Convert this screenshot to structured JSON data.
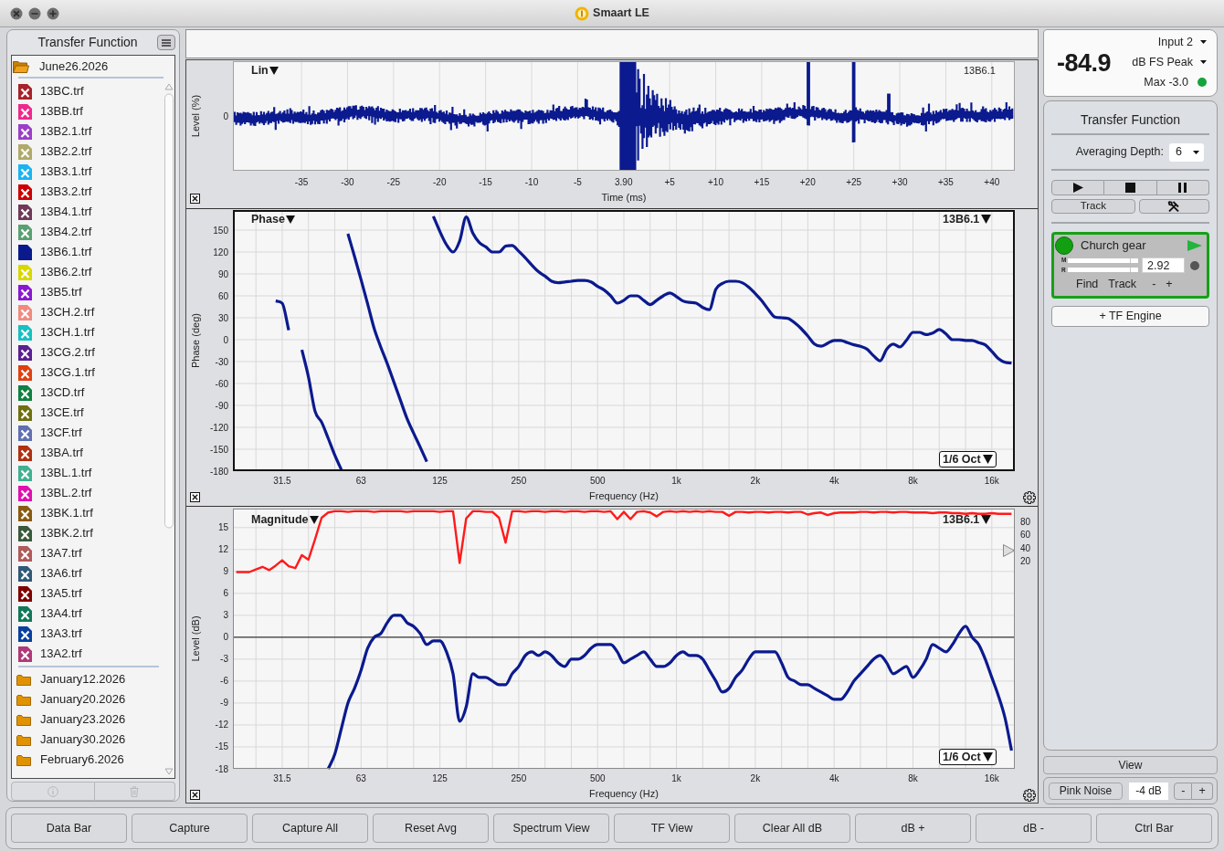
{
  "window": {
    "title": "Smaart LE"
  },
  "sidebar": {
    "title": "Transfer Function",
    "folders": [
      {
        "name": "June26.2026",
        "expanded": true,
        "files": [
          {
            "name": "13BC.trf",
            "color": "#a8222a",
            "visible": false
          },
          {
            "name": "13BB.trf",
            "color": "#f0288c",
            "visible": false
          },
          {
            "name": "13B2.1.trf",
            "color": "#9b3fc8",
            "visible": false
          },
          {
            "name": "13B2.2.trf",
            "color": "#b0aa6a",
            "visible": false
          },
          {
            "name": "13B3.1.trf",
            "color": "#1ab4f0",
            "visible": false
          },
          {
            "name": "13B3.2.trf",
            "color": "#cc0000",
            "visible": false
          },
          {
            "name": "13B4.1.trf",
            "color": "#6e3a58",
            "visible": false
          },
          {
            "name": "13B4.2.trf",
            "color": "#5aa070",
            "visible": false
          },
          {
            "name": "13B6.1.trf",
            "color": "#0a1a8c",
            "visible": true
          },
          {
            "name": "13B6.2.trf",
            "color": "#d8d800",
            "visible": false
          },
          {
            "name": "13B5.trf",
            "color": "#8a18d0",
            "visible": false
          },
          {
            "name": "13CH.2.trf",
            "color": "#f08a80",
            "visible": false
          },
          {
            "name": "13CH.1.trf",
            "color": "#18c0c0",
            "visible": false
          },
          {
            "name": "13CG.2.trf",
            "color": "#5a2090",
            "visible": false
          },
          {
            "name": "13CG.1.trf",
            "color": "#e04010",
            "visible": false
          },
          {
            "name": "13CD.trf",
            "color": "#108040",
            "visible": false
          },
          {
            "name": "13CE.trf",
            "color": "#707010",
            "visible": false
          },
          {
            "name": "13CF.trf",
            "color": "#6070b0",
            "visible": false
          },
          {
            "name": "13BA.trf",
            "color": "#b03010",
            "visible": false
          },
          {
            "name": "13BL.1.trf",
            "color": "#40b090",
            "visible": false
          },
          {
            "name": "13BL.2.trf",
            "color": "#e010b0",
            "visible": false
          },
          {
            "name": "13BK.1.trf",
            "color": "#8a5a10",
            "visible": false
          },
          {
            "name": "13BK.2.trf",
            "color": "#3a5a3a",
            "visible": false
          },
          {
            "name": "13A7.trf",
            "color": "#b05a5a",
            "visible": false
          },
          {
            "name": "13A6.trf",
            "color": "#305878",
            "visible": false
          },
          {
            "name": "13A5.trf",
            "color": "#800000",
            "visible": false
          },
          {
            "name": "13A4.trf",
            "color": "#107858",
            "visible": false
          },
          {
            "name": "13A3.trf",
            "color": "#0840a0",
            "visible": false
          },
          {
            "name": "13A2.trf",
            "color": "#b03878",
            "visible": false
          }
        ]
      },
      {
        "name": "January12.2026",
        "expanded": false
      },
      {
        "name": "January20.2026",
        "expanded": false
      },
      {
        "name": "January23.2026",
        "expanded": false
      },
      {
        "name": "January30.2026",
        "expanded": false
      },
      {
        "name": "February6.2026",
        "expanded": false
      }
    ],
    "footer_buttons": [
      {
        "kind": "info",
        "disabled": true
      },
      {
        "kind": "trash",
        "disabled": true
      }
    ]
  },
  "impulse_pane": {
    "selected": false,
    "mode": "Lin",
    "trace_label": "13B6.1",
    "ylabel": "Level (%)",
    "yticks": [
      "0"
    ],
    "xticks": [
      "-35",
      "-30",
      "-25",
      "-20",
      "-15",
      "-10",
      "-5",
      "3.90",
      "+5",
      "+10",
      "+15",
      "+20",
      "+25",
      "+30",
      "+35",
      "+40"
    ],
    "xlabel": "Time (ms)"
  },
  "phase_pane": {
    "selected": true,
    "mode": "Phase",
    "smoothing": "1/6 Oct",
    "chart_data": {
      "type": "line",
      "xlabel": "Frequency (Hz)",
      "ylabel": "Phase (deg)",
      "grid": true,
      "categories": [
        null,
        null,
        null,
        null,
        null,
        null,
        null,
        "31.5",
        null,
        null,
        null,
        null,
        null,
        null,
        null,
        null,
        null,
        null,
        null,
        "63",
        null,
        null,
        null,
        null,
        null,
        null,
        null,
        null,
        null,
        null,
        null,
        "125",
        null,
        null,
        null,
        null,
        null,
        null,
        null,
        null,
        null,
        null,
        null,
        "250",
        null,
        null,
        null,
        null,
        null,
        null,
        null,
        null,
        null,
        null,
        null,
        "500",
        null,
        null,
        null,
        null,
        null,
        null,
        null,
        null,
        null,
        null,
        null,
        "1k",
        null,
        null,
        null,
        null,
        null,
        null,
        null,
        null,
        null,
        null,
        null,
        "2k",
        null,
        null,
        null,
        null,
        null,
        null,
        null,
        null,
        null,
        null,
        null,
        "4k",
        null,
        null,
        null,
        null,
        null,
        null,
        null,
        null,
        null,
        null,
        null,
        "8k",
        null,
        null,
        null,
        null,
        null,
        null,
        null,
        null,
        null,
        null,
        null,
        "16k",
        null,
        null,
        null
      ],
      "ylim": [
        -180,
        177.5
      ],
      "yticks": [
        150,
        120,
        90,
        60,
        30,
        0,
        -30,
        -60,
        -90,
        -120,
        -150,
        -180
      ],
      "series": [
        {
          "name": "13B6.1",
          "color": "#0b1a8e",
          "values": [
            null,
            null,
            null,
            null,
            null,
            null,
            53,
            50,
            13,
            null,
            -14,
            -51,
            -98,
            -113,
            -135,
            -158,
            -178,
            145,
            114,
            82,
            49,
            15,
            -10,
            -33,
            -58,
            -83,
            -108,
            -128,
            -147,
            -167,
            169,
            148,
            130,
            120,
            135,
            168,
            146,
            133,
            127,
            120,
            120,
            128,
            129,
            121,
            112,
            102,
            93,
            87,
            80,
            78,
            79,
            80,
            81,
            81,
            79,
            73,
            68,
            60,
            50,
            54,
            60,
            60,
            54,
            48,
            54,
            60,
            64,
            59,
            53,
            51,
            50,
            44,
            41,
            69,
            77,
            80,
            80,
            78,
            72,
            63,
            53,
            41,
            31,
            30,
            29,
            23,
            15,
            5,
            -6,
            -9,
            -5,
            -1,
            -1,
            -4,
            -7,
            -9,
            -13,
            -22,
            -29,
            -13,
            -6,
            -10,
            -1,
            10,
            10,
            7,
            9,
            14,
            8,
            0,
            0,
            -1,
            -1,
            -4,
            -7,
            -16,
            -26,
            -31,
            -32
          ]
        }
      ]
    }
  },
  "magnitude_pane": {
    "selected": false,
    "mode": "Magnitude",
    "smoothing": "1/6 Oct",
    "chart_data": {
      "type": "line",
      "xlabel": "Frequency (Hz)",
      "ylabel": "Level (dB)",
      "grid": true,
      "categories": [
        null,
        null,
        null,
        null,
        null,
        null,
        null,
        "31.5",
        null,
        null,
        null,
        null,
        null,
        null,
        null,
        null,
        null,
        null,
        null,
        "63",
        null,
        null,
        null,
        null,
        null,
        null,
        null,
        null,
        null,
        null,
        null,
        "125",
        null,
        null,
        null,
        null,
        null,
        null,
        null,
        null,
        null,
        null,
        null,
        "250",
        null,
        null,
        null,
        null,
        null,
        null,
        null,
        null,
        null,
        null,
        null,
        "500",
        null,
        null,
        null,
        null,
        null,
        null,
        null,
        null,
        null,
        null,
        null,
        "1k",
        null,
        null,
        null,
        null,
        null,
        null,
        null,
        null,
        null,
        null,
        null,
        "2k",
        null,
        null,
        null,
        null,
        null,
        null,
        null,
        null,
        null,
        null,
        null,
        "4k",
        null,
        null,
        null,
        null,
        null,
        null,
        null,
        null,
        null,
        null,
        null,
        "8k",
        null,
        null,
        null,
        null,
        null,
        null,
        null,
        null,
        null,
        null,
        null,
        "16k",
        null,
        null,
        null
      ],
      "ylim": [
        -18,
        17.6
      ],
      "y2lim": [
        -297.5,
        100
      ],
      "yticks": [
        15,
        12,
        9,
        6,
        3,
        0,
        -3,
        -6,
        -9,
        -12,
        -15,
        -18
      ],
      "y2ticks": [
        80,
        60,
        40,
        20
      ],
      "ref_lines": [
        {
          "axis": "y",
          "value": 0
        }
      ],
      "series": [
        {
          "name": "13B6.1",
          "color": "#0b1a8e",
          "values": [
            null,
            null,
            null,
            null,
            null,
            null,
            null,
            null,
            null,
            null,
            null,
            null,
            null,
            null,
            -18,
            -16,
            -12.5,
            -9,
            -7,
            -4.5,
            -1.5,
            0,
            0.5,
            2,
            3,
            3,
            2,
            1.5,
            0.5,
            -1,
            -0.5,
            -0.5,
            -2,
            -5,
            -11.5,
            -9.5,
            -5,
            -5.5,
            -5.5,
            -6,
            -6.5,
            -6.5,
            -5,
            -4,
            -2.5,
            -2,
            -2.5,
            -2,
            -2.5,
            -3.5,
            -4,
            -3,
            -3,
            -2.5,
            -1.5,
            -1,
            -1,
            -1,
            -2,
            -3.5,
            -3,
            -2.5,
            -2,
            -3,
            -4,
            -4,
            -3.5,
            -2.5,
            -2,
            -2.5,
            -2.5,
            -3,
            -4.5,
            -6,
            -7.5,
            -7,
            -5.5,
            -4.5,
            -3,
            -2,
            -2,
            -2,
            -2,
            -3.5,
            -5.5,
            -6,
            -6.5,
            -6.5,
            -7,
            -7.5,
            -8,
            -8.5,
            -8.5,
            -7.5,
            -6,
            -5,
            -4,
            -3,
            -2.5,
            -3.5,
            -5,
            -4.5,
            -4,
            -5.5,
            -4.5,
            -3,
            -1,
            -1.5,
            -2,
            -1,
            0.5,
            1.5,
            0,
            -1,
            -3,
            -5.5,
            -8,
            -11,
            -15.5
          ]
        },
        {
          "color": "#ff1a1a",
          "axis": "y2",
          "values": [
            3,
            3,
            3,
            7,
            11,
            6,
            13,
            21,
            12,
            9,
            29,
            22,
            53,
            86,
            94,
            96,
            96,
            95,
            96,
            96,
            96,
            95,
            96,
            96,
            96,
            96,
            95,
            96,
            96,
            96,
            96,
            95,
            96,
            96,
            17,
            85,
            96,
            96,
            95,
            95,
            86,
            48,
            96,
            96,
            95,
            96,
            96,
            95,
            96,
            96,
            95,
            96,
            96,
            95,
            96,
            96,
            95,
            96,
            84,
            95,
            84,
            95,
            96,
            94,
            88,
            95,
            96,
            95,
            96,
            95,
            96,
            95,
            96,
            95,
            95,
            89,
            95,
            95,
            94,
            95,
            95,
            94,
            95,
            95,
            94,
            95,
            95,
            91,
            93,
            94,
            90,
            93,
            94,
            94,
            94,
            95,
            95,
            94,
            95,
            95,
            94,
            95,
            95,
            94,
            94,
            94,
            93,
            94,
            94,
            93,
            93,
            92,
            93,
            92,
            92,
            93,
            92,
            92,
            92
          ]
        }
      ]
    }
  },
  "meter": {
    "reading": "-84.9",
    "input": "Input 2",
    "scale": "dB FS Peak",
    "max": "Max -3.0"
  },
  "tf_panel": {
    "title": "Transfer Function",
    "averaging_label": "Averaging Depth:",
    "averaging_value": "6",
    "track_button": "Track",
    "engines": [
      {
        "name": "Church gear",
        "active": true,
        "meters": [
          {
            "label": "M"
          },
          {
            "label": "R"
          }
        ],
        "delay": "2.92",
        "actions": [
          "Find",
          "Track",
          "-",
          "+"
        ]
      }
    ],
    "add_engine": "+ TF Engine"
  },
  "view_button": "View",
  "generator": {
    "button": "Pink Noise",
    "gain": "-4 dB",
    "steppers": [
      "-",
      "+"
    ]
  },
  "toolbar": [
    "Data Bar",
    "Capture",
    "Capture All",
    "Reset Avg",
    "Spectrum View",
    "TF View",
    "Clear All dB",
    "dB +",
    "dB -",
    "Ctrl Bar"
  ]
}
